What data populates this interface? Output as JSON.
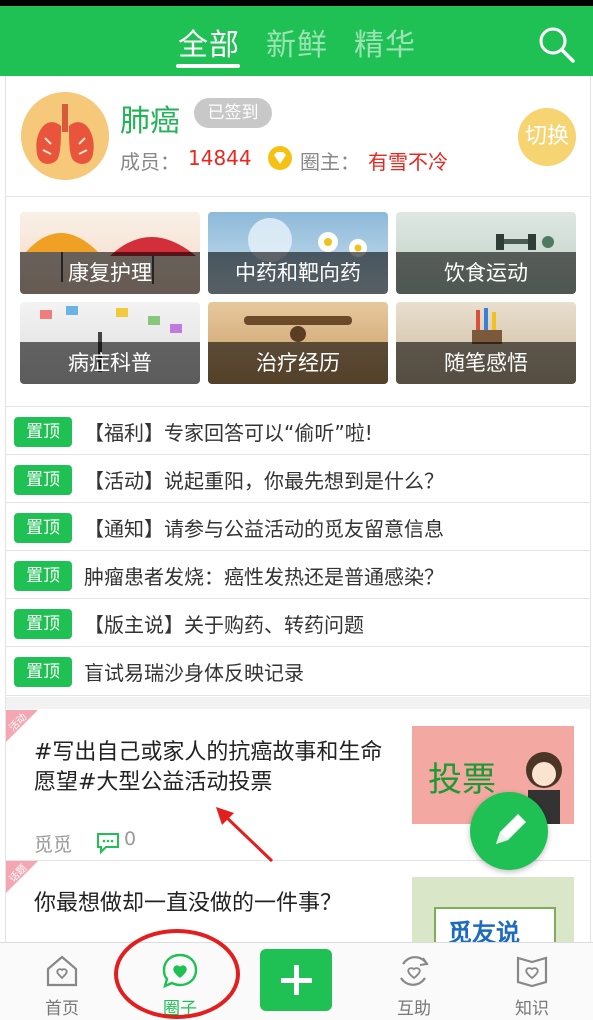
{
  "header": {
    "tabs": [
      {
        "label": "全部",
        "active": true
      },
      {
        "label": "新鲜",
        "active": false
      },
      {
        "label": "精华",
        "active": false
      }
    ],
    "search_icon": "search-icon"
  },
  "circle": {
    "name": "肺癌",
    "signed_badge": "已签到",
    "members_label": "成员：",
    "members_count": "14844",
    "owner_label": "圈主：",
    "owner_name": "有雪不冷",
    "switch_label": "切换"
  },
  "categories": [
    {
      "label": "康复护理"
    },
    {
      "label": "中药和靶向药"
    },
    {
      "label": "饮食运动"
    },
    {
      "label": "病症科普"
    },
    {
      "label": "治疗经历"
    },
    {
      "label": "随笔感悟"
    }
  ],
  "pinned": {
    "tag": "置顶",
    "items": [
      "【福利】专家回答可以“偷听”啦!",
      "【活动】说起重阳，你最先想到是什么？",
      "【通知】请参与公益活动的觅友留意信息",
      "肿瘤患者发烧：癌性发热还是普通感染？",
      "【版主说】关于购药、转药问题",
      "盲试易瑞沙身体反映记录"
    ]
  },
  "posts": [
    {
      "ribbon": "活动",
      "title": "#写出自己或家人的抗癌故事和生命愿望#大型公益活动投票",
      "thumb_text": "投票",
      "author": "觅觅",
      "comments": "0"
    },
    {
      "ribbon": "话题",
      "title": "你最想做却一直没做的一件事？",
      "thumb_text": "觅友说"
    }
  ],
  "bottom_nav": [
    {
      "label": "首页",
      "icon": "home-icon"
    },
    {
      "label": "圈子",
      "icon": "circle-icon",
      "active": true
    },
    {
      "label": "",
      "icon": "plus-icon"
    },
    {
      "label": "互助",
      "icon": "help-icon"
    },
    {
      "label": "知识",
      "icon": "knowledge-icon"
    }
  ],
  "colors": {
    "brand": "#1fc054",
    "accent_red": "#e8271f",
    "annotation_red": "#e21e1e"
  }
}
